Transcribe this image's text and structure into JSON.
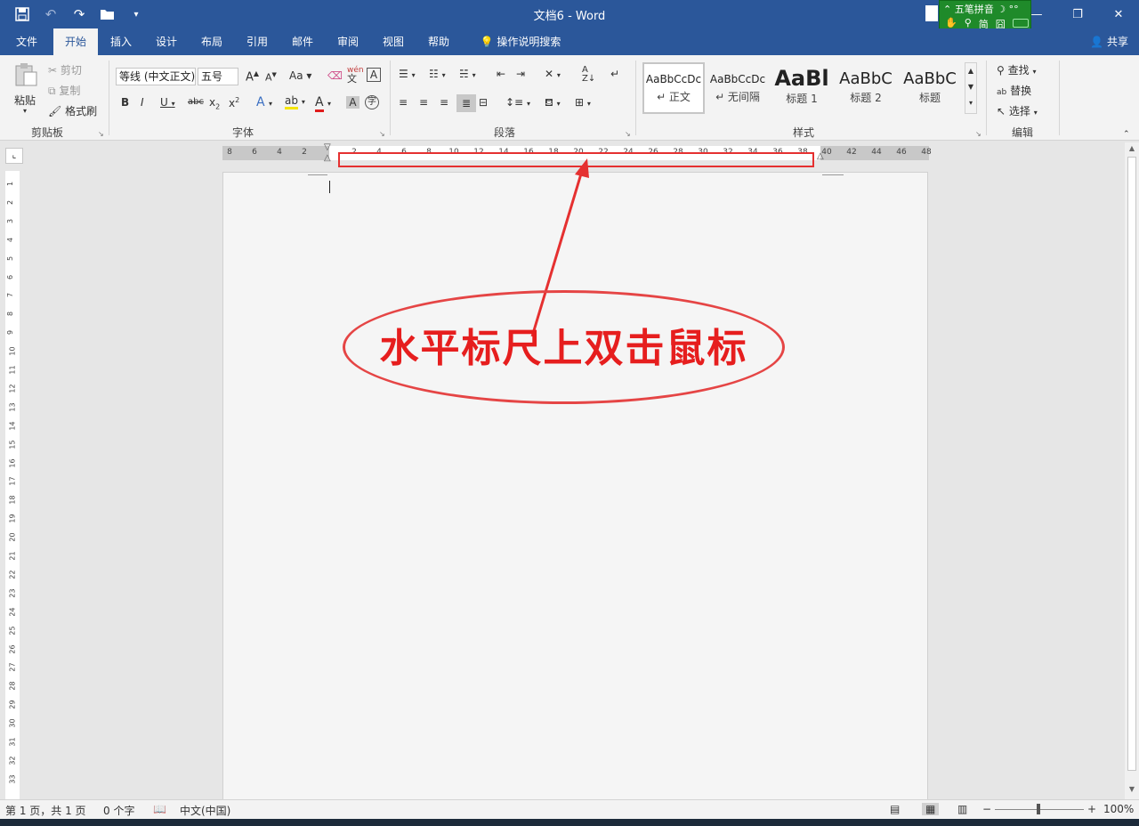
{
  "window": {
    "title": "文档6  -  Word",
    "min_label": "—",
    "restore_label": "❐",
    "close_label": "✕"
  },
  "ime": {
    "name": "五笔拼音",
    "mode1": "简",
    "mode2": "囧"
  },
  "tabs": [
    "文件",
    "开始",
    "插入",
    "设计",
    "布局",
    "引用",
    "邮件",
    "审阅",
    "视图",
    "帮助"
  ],
  "tell_me": "操作说明搜索",
  "share": "共享",
  "ribbon": {
    "clipboard": {
      "label": "剪贴板",
      "paste": "粘贴",
      "cut": "剪切",
      "copy": "复制",
      "painter": "格式刷"
    },
    "font": {
      "label": "字体",
      "font_name": "等线 (中文正文)",
      "font_size": "五号",
      "aa": "Aa",
      "wen": "wén"
    },
    "paragraph": {
      "label": "段落"
    },
    "styles": {
      "label": "样式",
      "items": [
        {
          "sample": "AaBbCcDc",
          "name": "↵ 正文"
        },
        {
          "sample": "AaBbCcDc",
          "name": "↵ 无间隔"
        },
        {
          "sample": "AaBl",
          "name": "标题 1"
        },
        {
          "sample": "AaBbC",
          "name": "标题 2"
        },
        {
          "sample": "AaBbC",
          "name": "标题"
        }
      ]
    },
    "editing": {
      "label": "编辑",
      "find": "查找",
      "replace": "替换",
      "select": "选择"
    }
  },
  "ruler": {
    "left_numbers": [
      "8",
      "6",
      "4",
      "2"
    ],
    "white_numbers": [
      "2",
      "4",
      "6",
      "8",
      "10",
      "12",
      "14",
      "16",
      "18",
      "20",
      "22",
      "24",
      "26",
      "28",
      "30",
      "32",
      "34",
      "36",
      "38"
    ],
    "right_numbers": [
      "40",
      "42",
      "44",
      "46",
      "48"
    ],
    "vertical_numbers": [
      "1",
      "2",
      "3",
      "4",
      "5",
      "6",
      "7",
      "8",
      "9",
      "10",
      "11",
      "12",
      "13",
      "14",
      "15",
      "16",
      "17",
      "18",
      "19",
      "20",
      "21",
      "22",
      "23",
      "24",
      "25",
      "26",
      "27",
      "28",
      "29",
      "30",
      "31",
      "32",
      "33"
    ]
  },
  "annotation": {
    "text": "水平标尺上双击鼠标",
    "color": "#e61e1e"
  },
  "status": {
    "page": "第 1 页，共 1 页",
    "words": "0 个字",
    "lang": "中文(中国)",
    "zoom": "100%"
  },
  "colors": {
    "brand": "#2b579a",
    "annotation_red": "#e53030"
  }
}
